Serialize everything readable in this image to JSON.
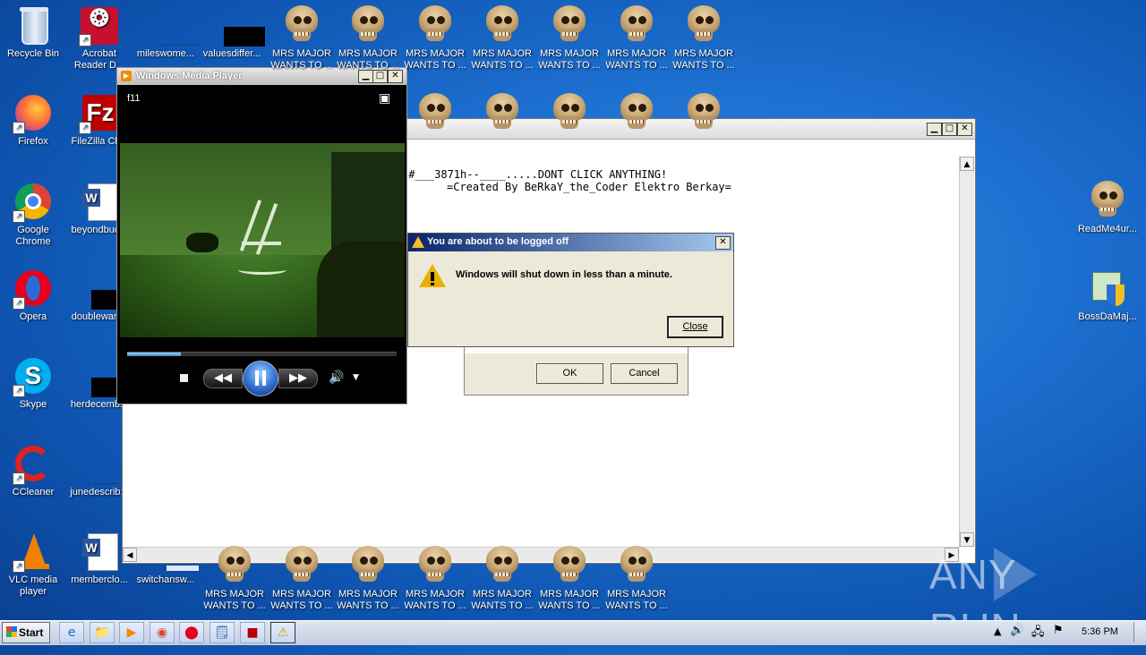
{
  "desktop_icons": {
    "recycle_bin": "Recycle Bin",
    "acrobat": "Acrobat Reader D...",
    "mileswomen": "mileswome...",
    "valuesdiffer": "valuesdiffer...",
    "firefox": "Firefox",
    "filezilla": "FileZilla Cli...",
    "chrome": "Google Chrome",
    "beyondbuc": "beyondbuc...",
    "opera": "Opera",
    "doublewan": "doublewan...",
    "skype": "Skype",
    "herdecemb": "herdecemb...",
    "ccleaner": "CCleaner",
    "junedescrib": "junedescrib...",
    "vlc": "VLC media player",
    "memberclo": "memberclo...",
    "switchansw": "switchansw...",
    "readme": "ReadMe4ur...",
    "bossdamaj": "BossDaMaj..."
  },
  "skull_top_label": "MRS MAJOR WANTS TO ...",
  "skull_top_line1": "MRS MAJOR",
  "skull_top_line2": "WANTS TO ...",
  "wmp": {
    "title": "Windows Media Player",
    "overlay_label": "f11",
    "progress": 0.2
  },
  "notepad": {
    "line1": "-#___3871h--____.....DONT CLICK ANYTHING!",
    "line2": "=Created By BeRkaY_the_Coder Elektro Berkay="
  },
  "logoff_dialog": {
    "title": "You are about to be logged off",
    "message": "Windows will shut down in less than a minute.",
    "close_button": "Close"
  },
  "back_dialog": {
    "ok_button": "OK",
    "cancel_button": "Cancel"
  },
  "taskbar": {
    "start_label": "Start",
    "clock": "5:36 PM"
  },
  "watermark": "ANY RUN"
}
